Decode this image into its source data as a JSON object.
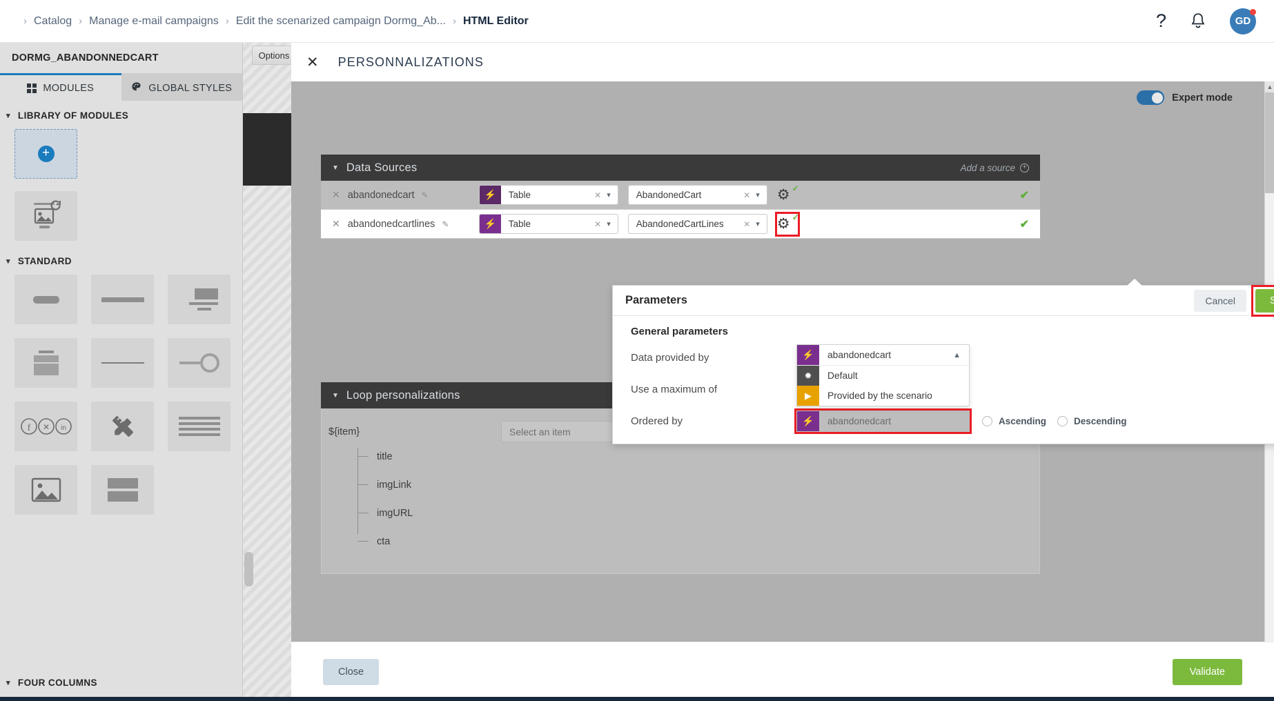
{
  "topbar": {
    "breadcrumb": [
      {
        "label": "Catalog",
        "active": false
      },
      {
        "label": "Manage e-mail campaigns",
        "active": false
      },
      {
        "label": "Edit the scenarized campaign Dormg_Ab...",
        "active": false
      },
      {
        "label": "HTML Editor",
        "active": true
      }
    ],
    "help_icon": "question-mark-icon",
    "bell_icon": "bell-icon",
    "avatar_initials": "GD"
  },
  "left_panel": {
    "title": "DORMG_ABANDONNEDCART",
    "tabs": [
      {
        "label": "MODULES",
        "icon": "grid-icon",
        "active": true
      },
      {
        "label": "GLOBAL STYLES",
        "icon": "palette-icon",
        "active": false
      }
    ],
    "groups": [
      {
        "label": "LIBRARY OF MODULES"
      },
      {
        "label": "STANDARD"
      },
      {
        "label": "FOUR COLUMNS"
      }
    ],
    "add_module_label": "+"
  },
  "canvas": {
    "options_label": "Options"
  },
  "modal": {
    "title": "PERSONNALIZATIONS",
    "close_icon": "close-icon",
    "expert_mode_label": "Expert mode",
    "expert_mode_on": true,
    "data_sources": {
      "title": "Data Sources",
      "add_source_label": "Add a source",
      "rows": [
        {
          "name": "abandonedcart",
          "type_value": "Table",
          "entity_value": "AbandonedCart",
          "status": "✔",
          "gear_highlighted": false
        },
        {
          "name": "abandonedcartlines",
          "type_value": "Table",
          "entity_value": "AbandonedCartLines",
          "status": "✔",
          "gear_highlighted": true
        }
      ]
    },
    "parameters": {
      "title": "Parameters",
      "cancel_label": "Cancel",
      "save_label": "Save",
      "general_label": "General parameters",
      "fields": [
        {
          "label": "Data provided by"
        },
        {
          "label": "Use a maximum of"
        },
        {
          "label": "Ordered by"
        }
      ],
      "dropdown": {
        "selected": "abandonedcart",
        "options": [
          {
            "label": "Default",
            "badge": "✱",
            "badge_color": "#4f4f4f"
          },
          {
            "label": "Provided by the scenario",
            "badge": "▶",
            "badge_color": "#e8a200"
          }
        ]
      },
      "ordered_by_value": "abandonedcart",
      "radios": [
        {
          "label": "Ascending",
          "selected": false
        },
        {
          "label": "Descending",
          "selected": false
        }
      ]
    },
    "loop": {
      "title": "Loop personalizations",
      "item_key": "${item}",
      "select_placeholder": "Select an item",
      "fields": [
        "title",
        "imgLink",
        "imgURL",
        "cta"
      ]
    },
    "footer": {
      "close_label": "Close",
      "validate_label": "Validate"
    }
  },
  "colors": {
    "accent_blue": "#1a7bbd",
    "green": "#7cba3d",
    "highlight_red": "#ea1c24",
    "purple": "#7a2f8f",
    "purple_dark": "#5c2a66",
    "orange": "#e8a200"
  }
}
